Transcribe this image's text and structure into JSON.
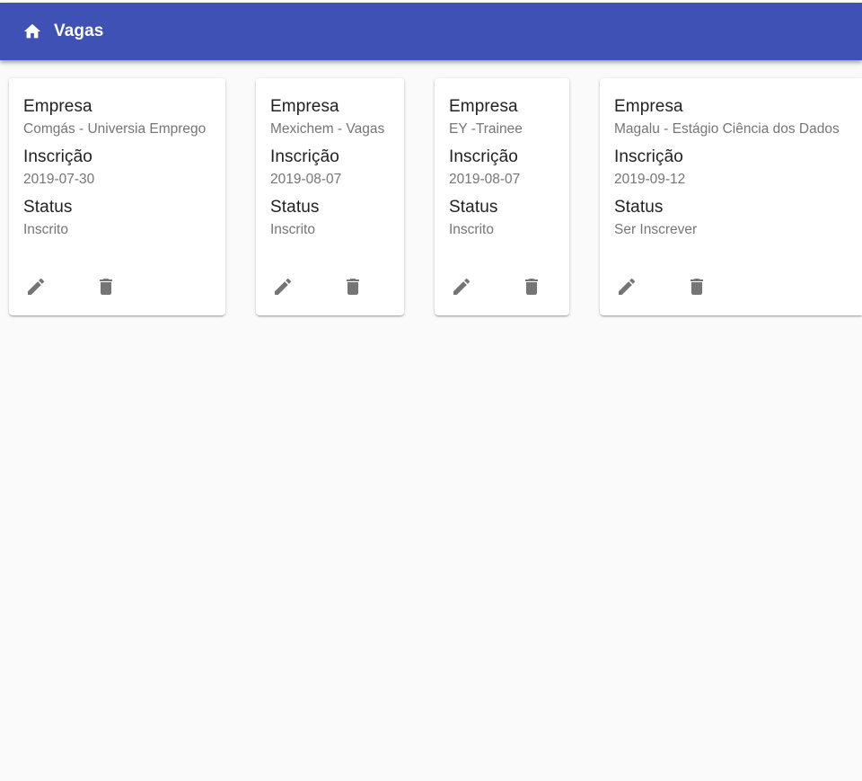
{
  "app_bar": {
    "title": "Vagas",
    "icon": "home-icon",
    "background_color": "#3f51b5"
  },
  "cards": [
    {
      "company_label": "Empresa",
      "company": "Comgás - Universia Emprego",
      "date_label": "Inscrição",
      "date": "2019-07-30",
      "status_label": "Status",
      "status": "Inscrito",
      "edit_icon": "pencil-icon",
      "delete_icon": "trash-icon"
    },
    {
      "company_label": "Empresa",
      "company": "Mexichem - Vagas",
      "date_label": "Inscrição",
      "date": "2019-08-07",
      "status_label": "Status",
      "status": "Inscrito",
      "edit_icon": "pencil-icon",
      "delete_icon": "trash-icon"
    },
    {
      "company_label": "Empresa",
      "company": "EY -Trainee",
      "date_label": "Inscrição",
      "date": "2019-08-07",
      "status_label": "Status",
      "status": "Inscrito",
      "edit_icon": "pencil-icon",
      "delete_icon": "trash-icon"
    },
    {
      "company_label": "Empresa",
      "company": "Magalu - Estágio Ciência dos Dados",
      "date_label": "Inscrição",
      "date": "2019-09-12",
      "status_label": "Status",
      "status": "Ser Inscrever",
      "edit_icon": "pencil-icon",
      "delete_icon": "trash-icon"
    }
  ],
  "colors": {
    "page_background": "#fafafa",
    "card_background": "#ffffff",
    "label_text": "#212121",
    "value_text": "#757575",
    "icon": "#757575"
  }
}
